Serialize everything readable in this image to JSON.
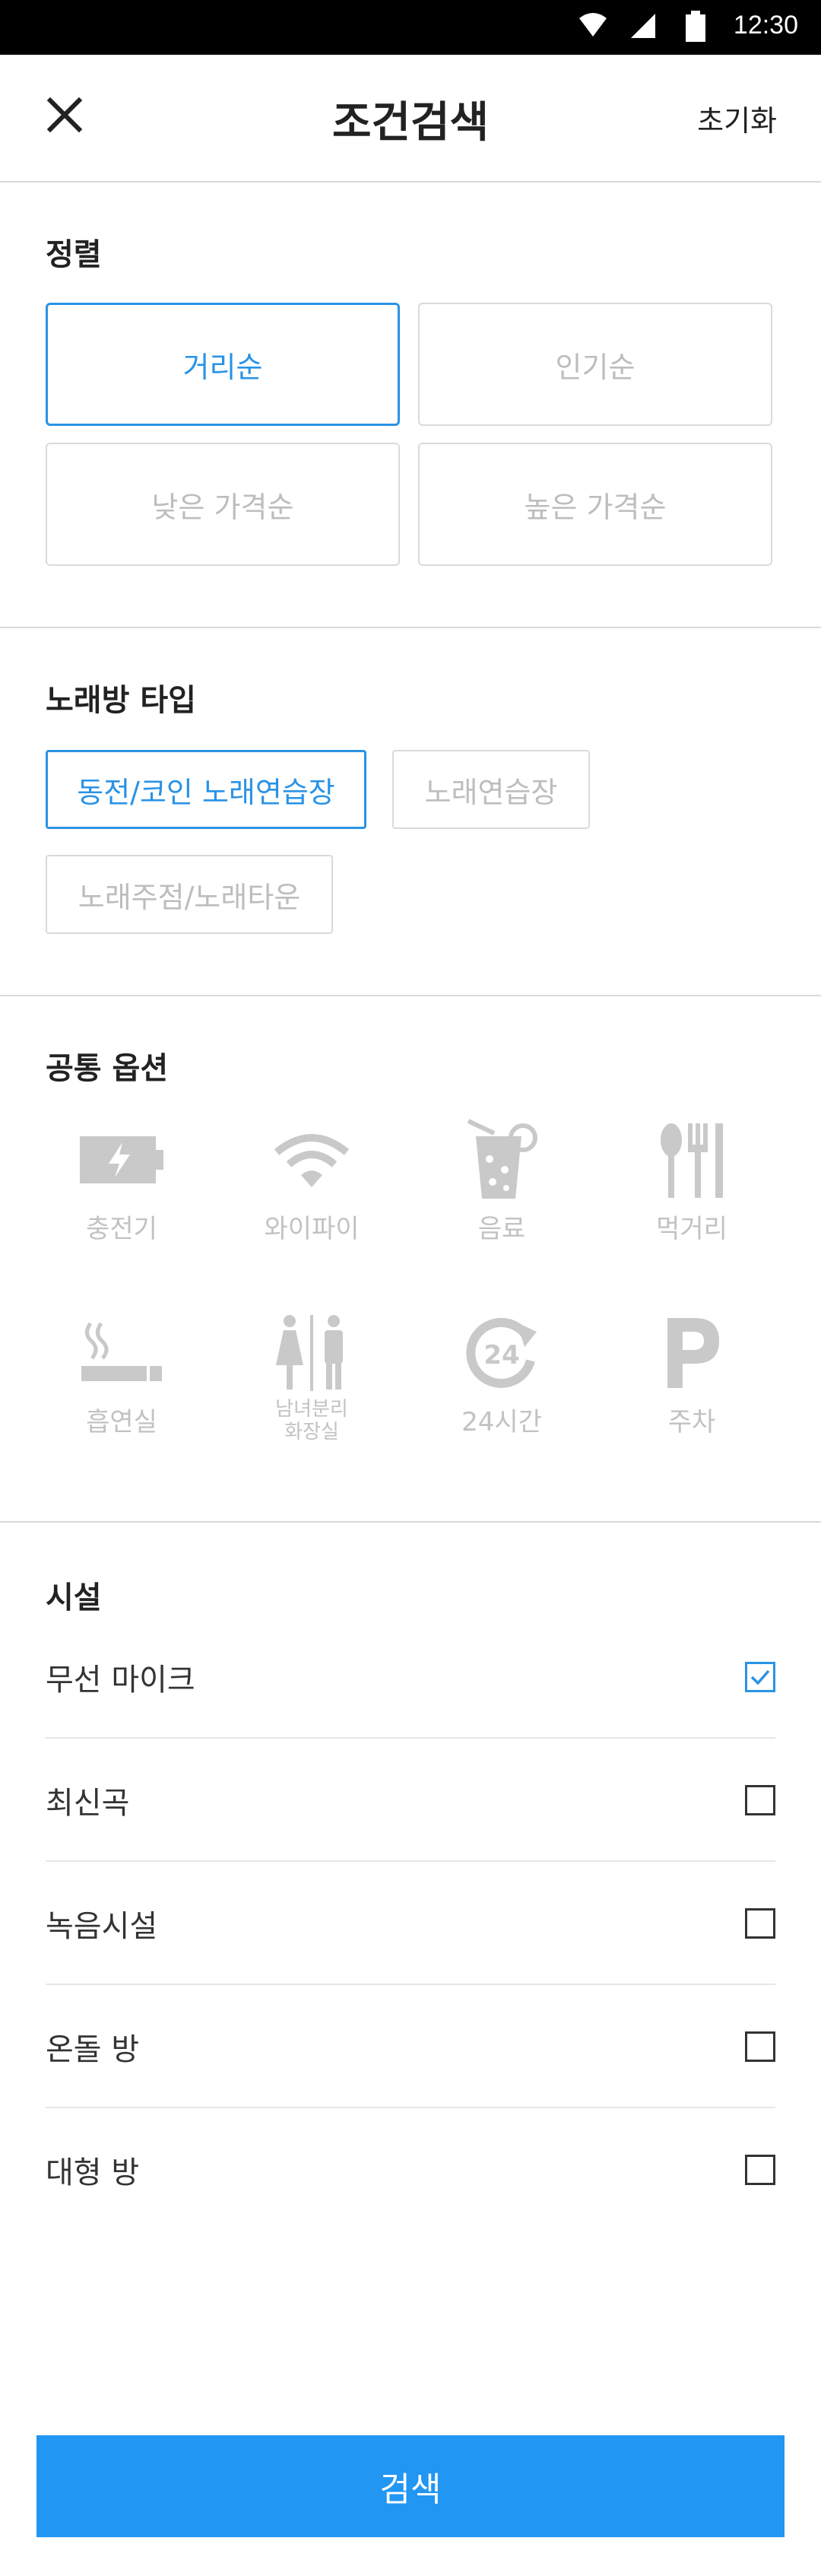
{
  "status": {
    "time": "12:30"
  },
  "header": {
    "title": "조건검색",
    "reset_label": "초기화"
  },
  "sort": {
    "title": "정렬",
    "options": [
      {
        "label": "거리순",
        "selected": true
      },
      {
        "label": "인기순",
        "selected": false
      },
      {
        "label": "낮은 가격순",
        "selected": false
      },
      {
        "label": "높은 가격순",
        "selected": false
      }
    ]
  },
  "room_type": {
    "title": "노래방 타입",
    "options": [
      {
        "label": "동전/코인 노래연습장",
        "selected": true
      },
      {
        "label": "노래연습장",
        "selected": false
      },
      {
        "label": "노래주점/노래타운",
        "selected": false
      }
    ]
  },
  "common": {
    "title": "공통 옵션",
    "options": [
      {
        "label": "충전기",
        "icon": "battery-charger-icon"
      },
      {
        "label": "와이파이",
        "icon": "wifi-icon"
      },
      {
        "label": "음료",
        "icon": "drink-icon"
      },
      {
        "label": "먹거리",
        "icon": "food-icon"
      },
      {
        "label": "흡연실",
        "icon": "smoking-icon"
      },
      {
        "label_line1": "남녀분리",
        "label_line2": "화장실",
        "icon": "restroom-icon"
      },
      {
        "label": "24시간",
        "icon": "24-hours-icon"
      },
      {
        "label": "주차",
        "icon": "parking-icon"
      }
    ]
  },
  "facilities": {
    "title": "시설",
    "items": [
      {
        "label": "무선 마이크",
        "checked": true
      },
      {
        "label": "최신곡",
        "checked": false
      },
      {
        "label": "녹음시설",
        "checked": false
      },
      {
        "label": "온돌 방",
        "checked": false
      },
      {
        "label": "대형 방",
        "checked": false
      }
    ]
  },
  "footer": {
    "search_label": "검색"
  },
  "colors": {
    "accent": "#2a93e5",
    "button": "#2196f3",
    "inactive": "#c2c2c2"
  }
}
